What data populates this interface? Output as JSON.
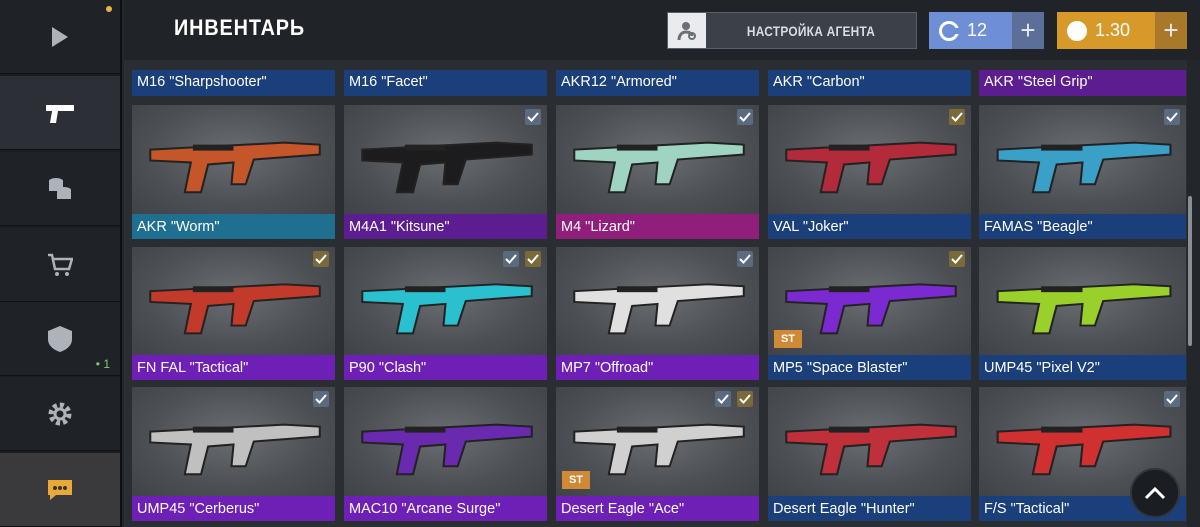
{
  "header": {
    "title": "ИНВЕНТАРЬ",
    "agent_button": "НАСТРОЙКА АГЕНТА",
    "currency_silver": "12",
    "currency_gold": "1.30",
    "plus": "+"
  },
  "sidebar": {
    "items": [
      {
        "name": "play",
        "icon": "play-icon"
      },
      {
        "name": "inventory",
        "icon": "pistol-icon",
        "active": true
      },
      {
        "name": "coins",
        "icon": "coins-stack-icon"
      },
      {
        "name": "shop",
        "icon": "cart-icon"
      },
      {
        "name": "clan",
        "icon": "shield-icon",
        "count": "• 1"
      },
      {
        "name": "settings",
        "icon": "gear-icon"
      },
      {
        "name": "chat",
        "icon": "chat-icon"
      }
    ]
  },
  "colors": {
    "blue": "#1b3f7a",
    "teal": "#1f6f91",
    "purple": "#5b1d8f",
    "violet": "#6e1fb5",
    "magenta": "#8f1f7a",
    "accent_gold": "#d79a2a",
    "accent_blue": "#6e8ed6"
  },
  "grid": {
    "rows": [
      [
        {
          "name": "M16 \"Sharpshooter\"",
          "rarity": "blue"
        },
        {
          "name": "M16 \"Facet\"",
          "rarity": "blue"
        },
        {
          "name": "AKR12 \"Armored\"",
          "rarity": "blue"
        },
        {
          "name": "AKR \"Carbon\"",
          "rarity": "blue"
        },
        {
          "name": "AKR \"Steel Grip\"",
          "rarity": "purple"
        }
      ],
      [
        {
          "name": "AKR \"Worm\"",
          "rarity": "teal"
        },
        {
          "name": "M4A1 \"Kitsune\"",
          "rarity": "purple",
          "checks": [
            "blue"
          ]
        },
        {
          "name": "M4 \"Lizard\"",
          "rarity": "magenta",
          "checks": [
            "blue"
          ]
        },
        {
          "name": "VAL \"Joker\"",
          "rarity": "blue",
          "checks": [
            "gold"
          ]
        },
        {
          "name": "FAMAS \"Beagle\"",
          "rarity": "blue",
          "checks": [
            "blue"
          ]
        }
      ],
      [
        {
          "name": "FN FAL \"Tactical\"",
          "rarity": "violet",
          "checks": [
            "gold"
          ]
        },
        {
          "name": "P90 \"Clash\"",
          "rarity": "violet",
          "checks": [
            "blue",
            "gold"
          ]
        },
        {
          "name": "MP7 \"Offroad\"",
          "rarity": "violet",
          "checks": [
            "blue"
          ]
        },
        {
          "name": "MP5 \"Space Blaster\"",
          "rarity": "blue",
          "checks": [
            "gold"
          ],
          "st": "ST"
        },
        {
          "name": "UMP45 \"Pixel V2\"",
          "rarity": "blue"
        }
      ],
      [
        {
          "name": "UMP45 \"Cerberus\"",
          "rarity": "violet",
          "checks": [
            "blue"
          ]
        },
        {
          "name": "MAC10 \"Arcane Surge\"",
          "rarity": "violet"
        },
        {
          "name": "Desert Eagle \"Ace\"",
          "rarity": "violet",
          "checks": [
            "blue",
            "gold"
          ],
          "st": "ST"
        },
        {
          "name": "Desert Eagle \"Hunter\"",
          "rarity": "blue"
        },
        {
          "name": "F/S \"Tactical\"",
          "rarity": "blue",
          "checks": [
            "blue"
          ]
        }
      ]
    ]
  }
}
